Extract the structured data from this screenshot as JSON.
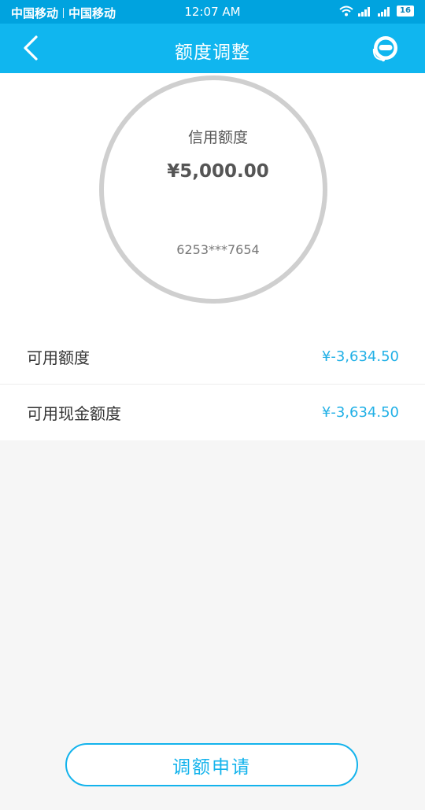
{
  "status_bar": {
    "carrier_1": "中国移动",
    "carrier_2": "中国移动",
    "time": "12:07 AM",
    "battery": "16",
    "icons": [
      "wifi-icon",
      "signal-icon",
      "signal-icon",
      "battery-icon"
    ]
  },
  "nav": {
    "title": "额度调整",
    "back_icon": "chevron-left-icon",
    "service_icon": "customer-service-icon"
  },
  "credit": {
    "label": "信用额度",
    "amount": "¥5,000.00",
    "card_number": "6253***7654"
  },
  "rows": [
    {
      "label": "可用额度",
      "value": "¥-3,634.50"
    },
    {
      "label": "可用现金额度",
      "value": "¥-3,634.50"
    }
  ],
  "apply_button": "调额申请",
  "colors": {
    "status_bar": "#00a3df",
    "nav_bar": "#10b6ef",
    "accent": "#13b3ec",
    "ring": "#cfcfcf"
  }
}
